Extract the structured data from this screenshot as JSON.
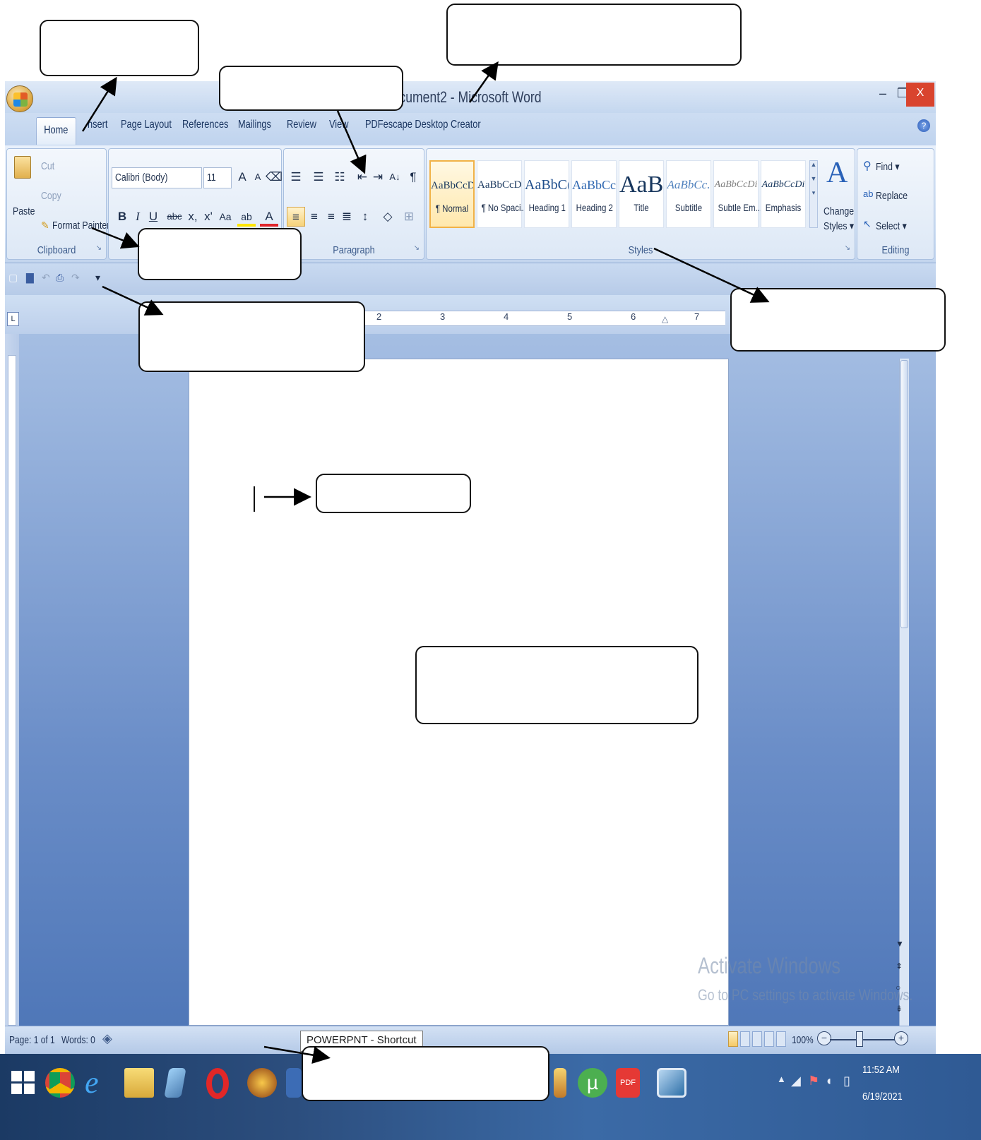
{
  "window": {
    "title": "Document2 - Microsoft Word",
    "title_visible": "cument2 - Microsoft Word",
    "min_symbol": "–",
    "max_symbol": "❐",
    "close_symbol": "X"
  },
  "tabs": [
    {
      "label": "Home",
      "active": true
    },
    {
      "label": "Insert",
      "visible": "nsert"
    },
    {
      "label": "Page Layout"
    },
    {
      "label": "References"
    },
    {
      "label": "Mailings"
    },
    {
      "label": "Review"
    },
    {
      "label": "View",
      "visible": "View"
    },
    {
      "label": "PDFescape Desktop Creator"
    }
  ],
  "help_symbol": "?",
  "ribbon": {
    "clipboard": {
      "label": "Clipboard",
      "paste": "Paste",
      "cut": "Cut",
      "copy": "Copy",
      "format_painter": "Format Painter"
    },
    "font": {
      "font_name": "Calibri (Body)",
      "font_size": "11",
      "grow": "A",
      "shrink": "A",
      "bold": "B",
      "italic": "I",
      "underline": "U",
      "strike": "abc",
      "subscript": "x,",
      "superscript": "x'",
      "change_case": "Aa",
      "highlight": "ab",
      "font_color": "A"
    },
    "paragraph": {
      "label": "Paragraph",
      "show_marks": "¶",
      "sort": "A↓"
    },
    "styles": {
      "label": "Styles",
      "items": [
        {
          "sample": "AaBbCcDc",
          "name": "¶ Normal"
        },
        {
          "sample": "AaBbCcDc",
          "name": "¶ No Spaci..."
        },
        {
          "sample": "AaBbC(",
          "name": "Heading 1"
        },
        {
          "sample": "AaBbCc",
          "name": "Heading 2"
        },
        {
          "sample": "AaB",
          "name": "Title"
        },
        {
          "sample": "AaBbCc.",
          "name": "Subtitle"
        },
        {
          "sample": "AaBbCcDi",
          "name": "Subtle Em..."
        },
        {
          "sample": "AaBbCcDi",
          "name": "Emphasis"
        }
      ],
      "change_styles_1": "Change",
      "change_styles_2": "Styles ▾"
    },
    "editing": {
      "label": "Editing",
      "find": "Find ▾",
      "replace": "Replace",
      "select": "Select ▾"
    }
  },
  "ruler": {
    "tab_selector": "L",
    "numbers": [
      "2",
      "3",
      "4",
      "5",
      "6",
      "7"
    ]
  },
  "status": {
    "page": "Page: 1 of 1",
    "words": "Words: 0",
    "tooltip": "POWERPNT - Shortcut",
    "zoom": "100%",
    "zoom_out": "−",
    "zoom_in": "+"
  },
  "watermark": {
    "line1": "Activate Windows",
    "line2": "Go to PC settings to activate Windows."
  },
  "taskbar": {
    "time": "11:52 AM",
    "date": "6/19/2021"
  },
  "colors": {
    "accent": "#2b579a",
    "active_style_border": "#f1b247",
    "close_button": "#d9442e"
  }
}
